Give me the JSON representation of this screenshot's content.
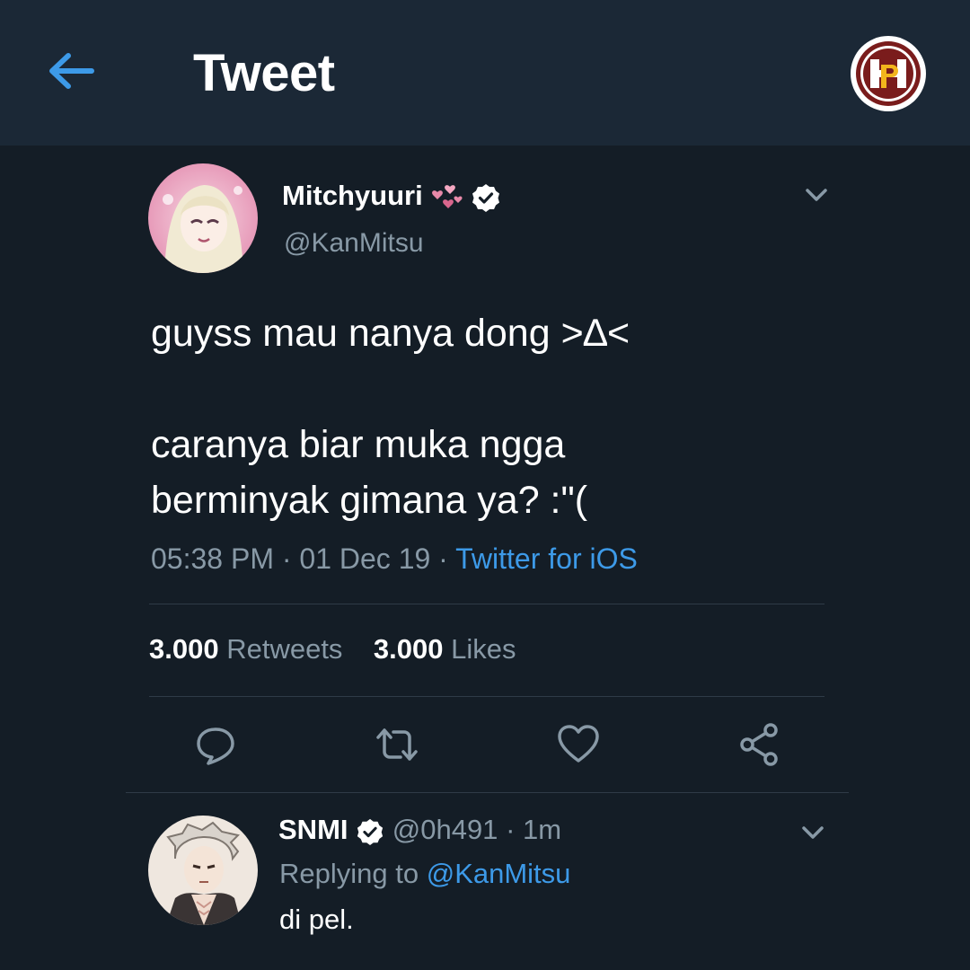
{
  "header": {
    "title": "Tweet",
    "back_icon": "arrow-left-icon",
    "logo_icon": "brand-logo-icon",
    "accent_color": "#3d9ae8"
  },
  "tweet": {
    "display_name": "Mitchyuuri",
    "name_emoji_icon": "pink-hearts-icon",
    "handle": "@KanMitsu",
    "verified": true,
    "text_line1": "guyss mau nanya dong >∆<",
    "text_line2": "caranya biar muka ngga",
    "text_line3": "berminyak gimana ya? :\"(",
    "time": "05:38 PM",
    "date": "01 Dec 19",
    "source": "Twitter for iOS",
    "retweets_count": "3.000",
    "retweets_label": "Retweets",
    "likes_count": "3.000",
    "likes_label": "Likes"
  },
  "actions": [
    {
      "icon": "reply-icon"
    },
    {
      "icon": "retweet-icon"
    },
    {
      "icon": "heart-icon"
    },
    {
      "icon": "share-icon"
    }
  ],
  "reply": {
    "display_name": "SNMI",
    "verified": true,
    "handle": "@0h491",
    "time": "1m",
    "replying_label": "Replying to",
    "replying_to": "@KanMitsu",
    "text": "di pel."
  },
  "separators": {
    "dot": "·"
  },
  "colors": {
    "background": "#141d26",
    "header": "#1b2836",
    "muted_text": "#8899a6",
    "link": "#3d9ae8",
    "divider": "#2f3b47"
  }
}
